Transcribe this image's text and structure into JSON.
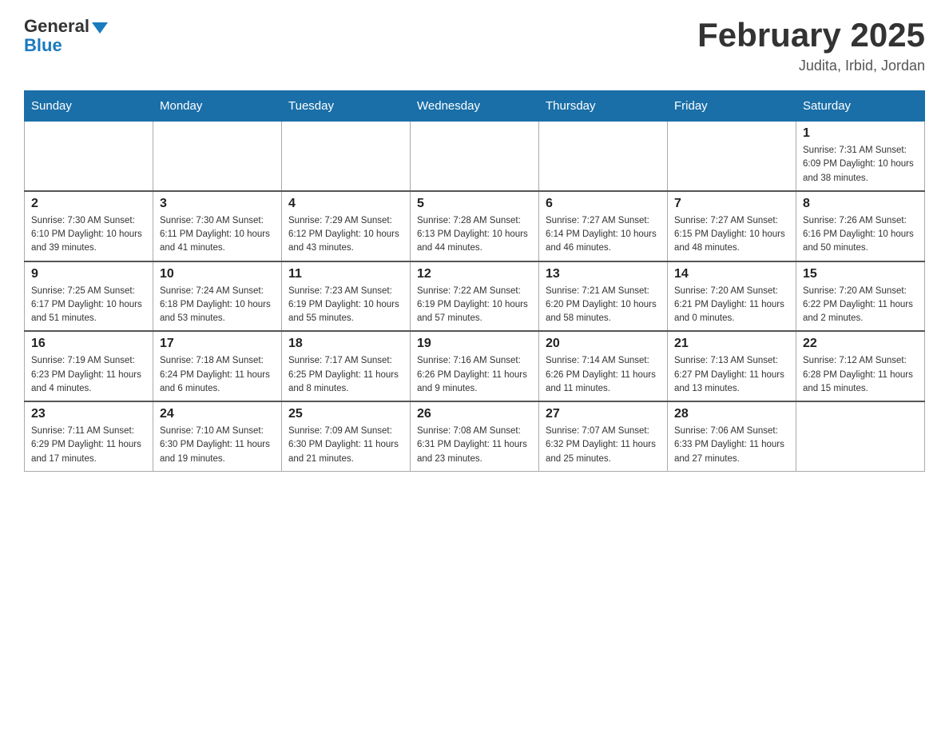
{
  "logo": {
    "general": "General",
    "blue": "Blue"
  },
  "title": "February 2025",
  "subtitle": "Judita, Irbid, Jordan",
  "days_of_week": [
    "Sunday",
    "Monday",
    "Tuesday",
    "Wednesday",
    "Thursday",
    "Friday",
    "Saturday"
  ],
  "weeks": [
    [
      {
        "day": "",
        "info": ""
      },
      {
        "day": "",
        "info": ""
      },
      {
        "day": "",
        "info": ""
      },
      {
        "day": "",
        "info": ""
      },
      {
        "day": "",
        "info": ""
      },
      {
        "day": "",
        "info": ""
      },
      {
        "day": "1",
        "info": "Sunrise: 7:31 AM\nSunset: 6:09 PM\nDaylight: 10 hours and 38 minutes."
      }
    ],
    [
      {
        "day": "2",
        "info": "Sunrise: 7:30 AM\nSunset: 6:10 PM\nDaylight: 10 hours and 39 minutes."
      },
      {
        "day": "3",
        "info": "Sunrise: 7:30 AM\nSunset: 6:11 PM\nDaylight: 10 hours and 41 minutes."
      },
      {
        "day": "4",
        "info": "Sunrise: 7:29 AM\nSunset: 6:12 PM\nDaylight: 10 hours and 43 minutes."
      },
      {
        "day": "5",
        "info": "Sunrise: 7:28 AM\nSunset: 6:13 PM\nDaylight: 10 hours and 44 minutes."
      },
      {
        "day": "6",
        "info": "Sunrise: 7:27 AM\nSunset: 6:14 PM\nDaylight: 10 hours and 46 minutes."
      },
      {
        "day": "7",
        "info": "Sunrise: 7:27 AM\nSunset: 6:15 PM\nDaylight: 10 hours and 48 minutes."
      },
      {
        "day": "8",
        "info": "Sunrise: 7:26 AM\nSunset: 6:16 PM\nDaylight: 10 hours and 50 minutes."
      }
    ],
    [
      {
        "day": "9",
        "info": "Sunrise: 7:25 AM\nSunset: 6:17 PM\nDaylight: 10 hours and 51 minutes."
      },
      {
        "day": "10",
        "info": "Sunrise: 7:24 AM\nSunset: 6:18 PM\nDaylight: 10 hours and 53 minutes."
      },
      {
        "day": "11",
        "info": "Sunrise: 7:23 AM\nSunset: 6:19 PM\nDaylight: 10 hours and 55 minutes."
      },
      {
        "day": "12",
        "info": "Sunrise: 7:22 AM\nSunset: 6:19 PM\nDaylight: 10 hours and 57 minutes."
      },
      {
        "day": "13",
        "info": "Sunrise: 7:21 AM\nSunset: 6:20 PM\nDaylight: 10 hours and 58 minutes."
      },
      {
        "day": "14",
        "info": "Sunrise: 7:20 AM\nSunset: 6:21 PM\nDaylight: 11 hours and 0 minutes."
      },
      {
        "day": "15",
        "info": "Sunrise: 7:20 AM\nSunset: 6:22 PM\nDaylight: 11 hours and 2 minutes."
      }
    ],
    [
      {
        "day": "16",
        "info": "Sunrise: 7:19 AM\nSunset: 6:23 PM\nDaylight: 11 hours and 4 minutes."
      },
      {
        "day": "17",
        "info": "Sunrise: 7:18 AM\nSunset: 6:24 PM\nDaylight: 11 hours and 6 minutes."
      },
      {
        "day": "18",
        "info": "Sunrise: 7:17 AM\nSunset: 6:25 PM\nDaylight: 11 hours and 8 minutes."
      },
      {
        "day": "19",
        "info": "Sunrise: 7:16 AM\nSunset: 6:26 PM\nDaylight: 11 hours and 9 minutes."
      },
      {
        "day": "20",
        "info": "Sunrise: 7:14 AM\nSunset: 6:26 PM\nDaylight: 11 hours and 11 minutes."
      },
      {
        "day": "21",
        "info": "Sunrise: 7:13 AM\nSunset: 6:27 PM\nDaylight: 11 hours and 13 minutes."
      },
      {
        "day": "22",
        "info": "Sunrise: 7:12 AM\nSunset: 6:28 PM\nDaylight: 11 hours and 15 minutes."
      }
    ],
    [
      {
        "day": "23",
        "info": "Sunrise: 7:11 AM\nSunset: 6:29 PM\nDaylight: 11 hours and 17 minutes."
      },
      {
        "day": "24",
        "info": "Sunrise: 7:10 AM\nSunset: 6:30 PM\nDaylight: 11 hours and 19 minutes."
      },
      {
        "day": "25",
        "info": "Sunrise: 7:09 AM\nSunset: 6:30 PM\nDaylight: 11 hours and 21 minutes."
      },
      {
        "day": "26",
        "info": "Sunrise: 7:08 AM\nSunset: 6:31 PM\nDaylight: 11 hours and 23 minutes."
      },
      {
        "day": "27",
        "info": "Sunrise: 7:07 AM\nSunset: 6:32 PM\nDaylight: 11 hours and 25 minutes."
      },
      {
        "day": "28",
        "info": "Sunrise: 7:06 AM\nSunset: 6:33 PM\nDaylight: 11 hours and 27 minutes."
      },
      {
        "day": "",
        "info": ""
      }
    ]
  ]
}
